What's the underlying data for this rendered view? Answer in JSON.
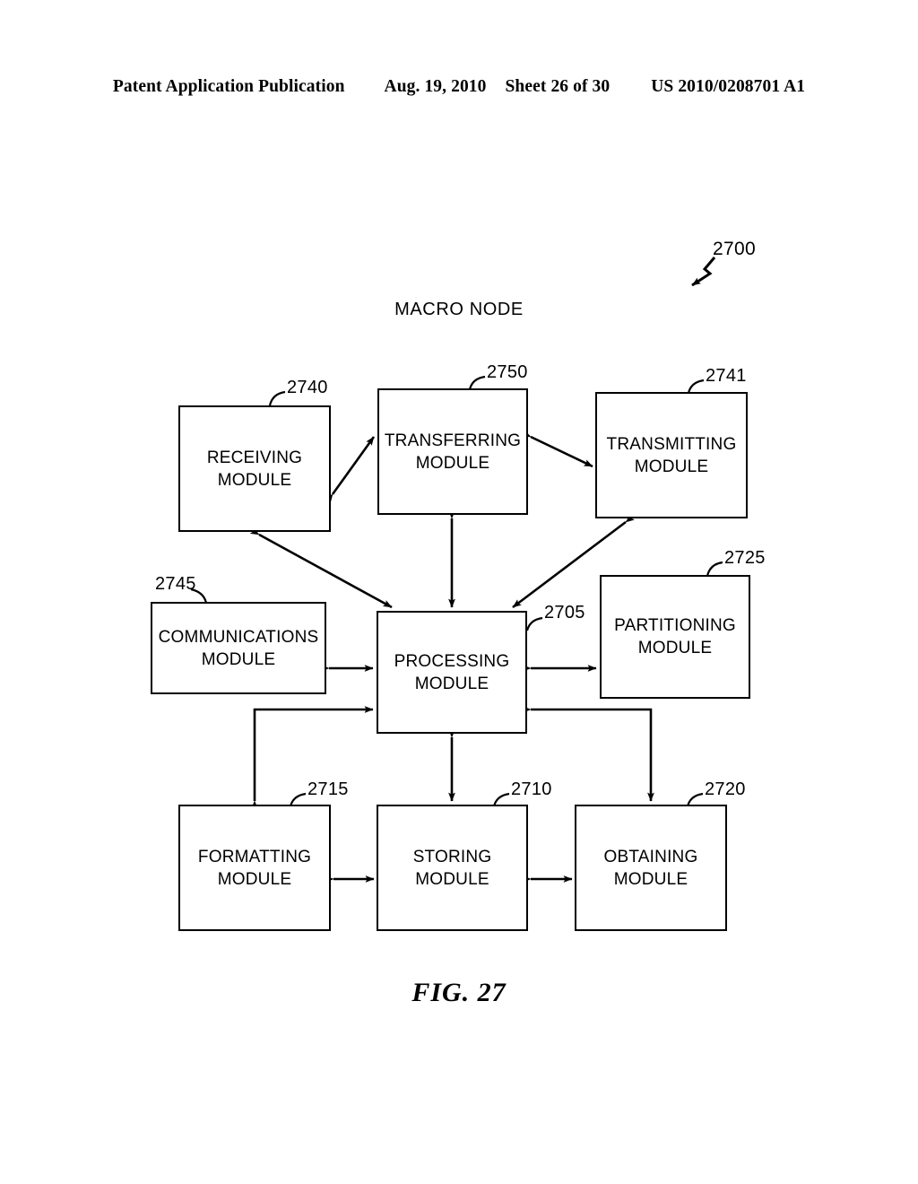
{
  "header": {
    "publication": "Patent Application Publication",
    "date": "Aug. 19, 2010",
    "sheet": "Sheet 26 of 30",
    "patent_number": "US 2010/0208701 A1"
  },
  "figure": {
    "caption": "FIG. 27",
    "diagram_title": "MACRO NODE",
    "system_ref": "2700"
  },
  "modules": {
    "receiving": {
      "label": "RECEIVING\nMODULE",
      "ref": "2740"
    },
    "transferring": {
      "label": "TRANSFERRING\nMODULE",
      "ref": "2750"
    },
    "transmitting": {
      "label": "TRANSMITTING\nMODULE",
      "ref": "2741"
    },
    "communications": {
      "label": "COMMUNICATIONS\nMODULE",
      "ref": "2745"
    },
    "processing": {
      "label": "PROCESSING\nMODULE",
      "ref": "2705"
    },
    "partitioning": {
      "label": "PARTITIONING\nMODULE",
      "ref": "2725"
    },
    "formatting": {
      "label": "FORMATTING\nMODULE",
      "ref": "2715"
    },
    "storing": {
      "label": "STORING\nMODULE",
      "ref": "2710"
    },
    "obtaining": {
      "label": "OBTAINING\nMODULE",
      "ref": "2720"
    }
  },
  "connections": [
    {
      "from": "receiving",
      "to": "transferring",
      "type": "bidirectional",
      "style": "diagonal"
    },
    {
      "from": "transferring",
      "to": "transmitting",
      "type": "bidirectional",
      "style": "diagonal"
    },
    {
      "from": "receiving",
      "to": "processing",
      "type": "bidirectional",
      "style": "diagonal"
    },
    {
      "from": "transferring",
      "to": "processing",
      "type": "bidirectional",
      "style": "vertical"
    },
    {
      "from": "transmitting",
      "to": "processing",
      "type": "bidirectional",
      "style": "diagonal"
    },
    {
      "from": "communications",
      "to": "processing",
      "type": "bidirectional",
      "style": "horizontal"
    },
    {
      "from": "processing",
      "to": "partitioning",
      "type": "bidirectional",
      "style": "horizontal"
    },
    {
      "from": "formatting",
      "to": "processing",
      "type": "bidirectional",
      "style": "elbow"
    },
    {
      "from": "processing",
      "to": "storing",
      "type": "bidirectional",
      "style": "vertical"
    },
    {
      "from": "processing",
      "to": "obtaining",
      "type": "bidirectional",
      "style": "elbow"
    },
    {
      "from": "formatting",
      "to": "storing",
      "type": "bidirectional",
      "style": "horizontal"
    },
    {
      "from": "storing",
      "to": "obtaining",
      "type": "bidirectional",
      "style": "horizontal"
    }
  ],
  "colors": {
    "line": "#000000",
    "background": "#ffffff",
    "text": "#000000"
  }
}
